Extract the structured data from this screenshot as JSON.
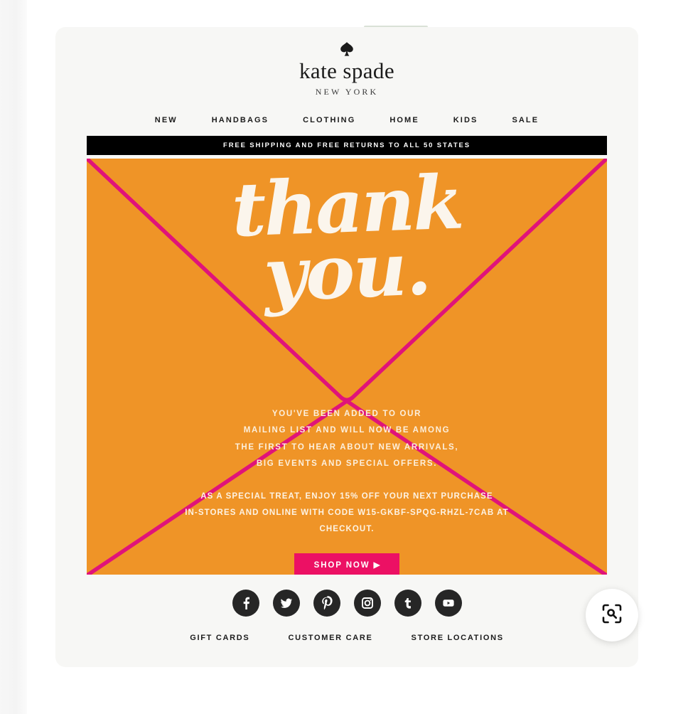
{
  "brand": {
    "logo_icon": "spade-icon",
    "wordmark": "kate spade",
    "locale": "NEW YORK"
  },
  "nav": {
    "items": [
      {
        "label": "NEW"
      },
      {
        "label": "HANDBAGS"
      },
      {
        "label": "CLOTHING"
      },
      {
        "label": "HOME"
      },
      {
        "label": "KIDS"
      },
      {
        "label": "SALE"
      }
    ]
  },
  "promo_bar": {
    "text": "FREE SHIPPING AND FREE RETURNS TO ALL 50 STATES",
    "background": "#000000",
    "color": "#ffffff"
  },
  "hero": {
    "headline_line1": "thank",
    "headline_line2": "you.",
    "background_color": "#ef9427",
    "line_color": "#e0137a",
    "headline_color": "#fbf5ec",
    "body_lines": [
      "YOU'VE BEEN ADDED TO OUR",
      "MAILING LIST AND WILL NOW BE AMONG",
      "THE FIRST TO HEAR ABOUT NEW ARRIVALS,",
      "BIG EVENTS AND SPECIAL OFFERS."
    ],
    "offer_lines": [
      "AS A SPECIAL TREAT, ENJOY 15% OFF YOUR NEXT PURCHASE",
      "IN-STORES AND ONLINE WITH CODE W15-GKBF-SPQG-RHZL-7CAB AT",
      "CHECKOUT."
    ],
    "discount": "15%",
    "promo_code": "W15-GKBF-SPQG-RHZL-7CAB",
    "cta": {
      "label": "SHOP NOW ▶",
      "background": "#ec1064",
      "color": "#ffffff"
    }
  },
  "social": {
    "items": [
      {
        "name": "facebook-icon",
        "glyph": "f"
      },
      {
        "name": "twitter-icon",
        "glyph": "t"
      },
      {
        "name": "pinterest-icon",
        "glyph": "P"
      },
      {
        "name": "instagram-icon",
        "glyph": "o"
      },
      {
        "name": "tumblr-icon",
        "glyph": "t"
      },
      {
        "name": "youtube-icon",
        "glyph": "▶"
      }
    ]
  },
  "footer": {
    "links": [
      {
        "label": "GIFT CARDS"
      },
      {
        "label": "CUSTOMER CARE"
      },
      {
        "label": "STORE LOCATIONS"
      }
    ]
  },
  "floating_action": {
    "icon": "visual-search-lens-icon"
  }
}
